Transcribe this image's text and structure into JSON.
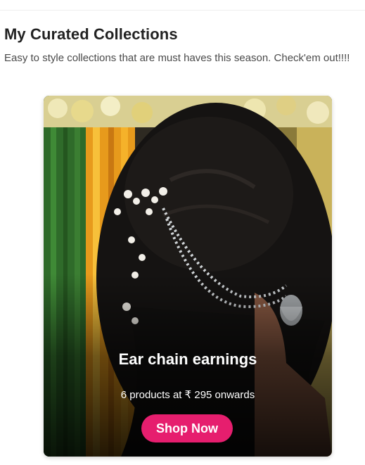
{
  "section": {
    "title": "My Curated Collections",
    "subtitle": "Easy to style collections that are must haves this season. Check'em out!!!!"
  },
  "collection_card": {
    "image": "woman-hair-with-ear-chain-jewelry",
    "title": "Ear chain earnings",
    "meta": "6 products at ₹ 295 onwards",
    "button_label": "Shop Now",
    "button_color": "#e61e6e"
  }
}
